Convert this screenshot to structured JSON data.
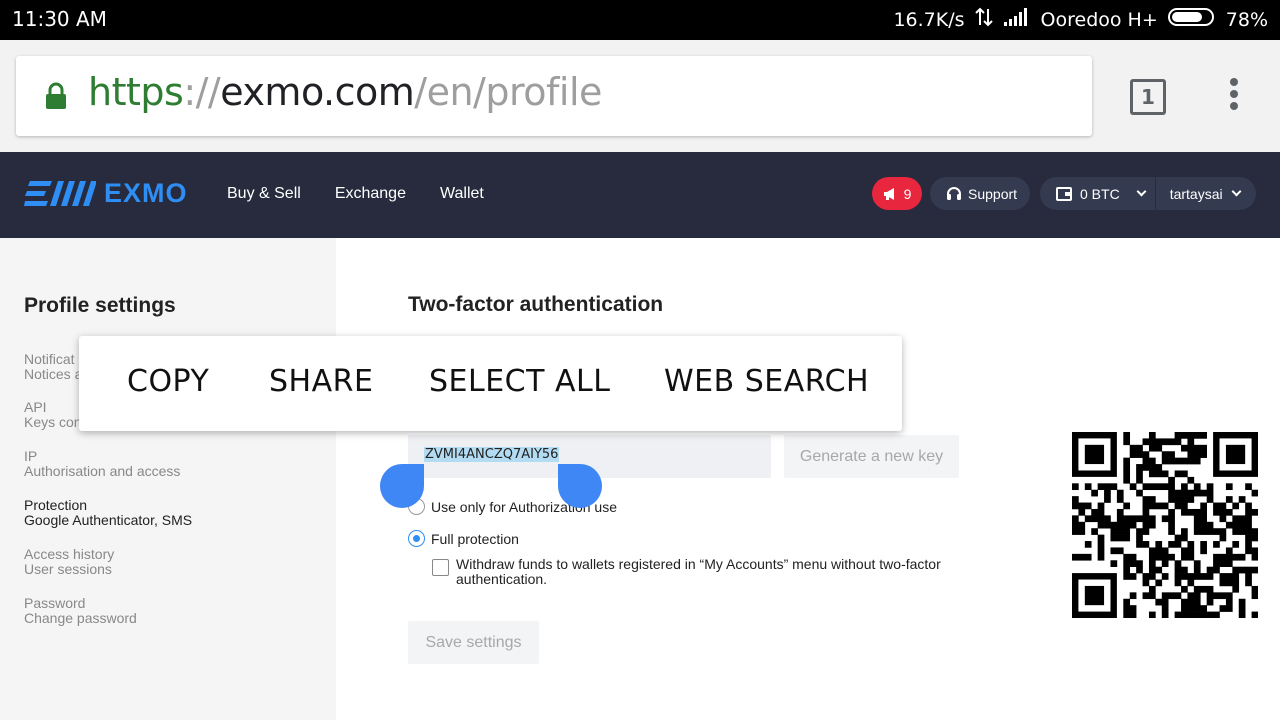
{
  "status_bar": {
    "time": "11:30 AM",
    "speed": "16.7K/s",
    "carrier": "Ooredoo H+",
    "battery": "78%",
    "battery_level": 0.78
  },
  "browser": {
    "url_scheme": "https",
    "url_separator": "://",
    "url_host": "exmo.com",
    "url_path": "/en/profile",
    "tab_count": "1"
  },
  "site_header": {
    "logo_text": "EXMO",
    "nav": [
      "Buy & Sell",
      "Exchange",
      "Wallet"
    ],
    "notification_count": "9",
    "support_label": "Support",
    "balance_label": "0 BTC",
    "username": "tartaysai",
    "brand_color": "#2e8ef3",
    "header_bg": "#272b3d",
    "alert_color": "#e8273e"
  },
  "sidebar": {
    "title": "Profile settings",
    "items": [
      {
        "title": "Notificat",
        "subtitle": "Notices a"
      },
      {
        "title": "API",
        "subtitle": "Keys con"
      },
      {
        "title": "IP",
        "subtitle": "Authorisation and access"
      },
      {
        "title": "Protection",
        "subtitle": "Google Authenticator, SMS"
      },
      {
        "title": "Access history",
        "subtitle": "User sessions"
      },
      {
        "title": "Password",
        "subtitle": "Change password"
      }
    ]
  },
  "main": {
    "title": "Two-factor authentication",
    "secret_key": "ZVMI4ANCZQ7AIY56",
    "generate_button": "Generate a new key",
    "radio_authorization": "Use only for Authorization use",
    "radio_full": "Full protection",
    "withdraw_checkbox": "Withdraw funds to wallets registered in “My Accounts” menu without two-factor authentication.",
    "save_button": "Save settings"
  },
  "context_menu": {
    "actions": [
      "COPY",
      "SHARE",
      "SELECT ALL",
      "WEB SEARCH"
    ]
  },
  "icons": [
    "lock-icon",
    "tabs-icon",
    "overflow-menu-icon",
    "megaphone-icon",
    "headset-icon",
    "wallet-icon",
    "chevron-down-icon",
    "qr-code"
  ]
}
